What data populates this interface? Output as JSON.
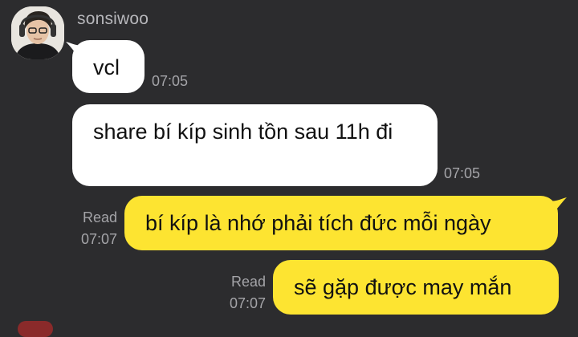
{
  "sender": {
    "name": "sonsiwoo",
    "avatar_icon": "profile-photo"
  },
  "messages": [
    {
      "direction": "in",
      "text": "vcl",
      "time": "07:05"
    },
    {
      "direction": "in",
      "text": "share bí kíp sinh tồn sau 11h đi",
      "time": "07:05"
    },
    {
      "direction": "out",
      "status": "Read",
      "text": "bí kíp là nhớ phải tích đức mỗi ngày",
      "time": "07:07"
    },
    {
      "direction": "out",
      "status": "Read",
      "text": "sẽ gặp được may mắn",
      "time": "07:07"
    }
  ],
  "colors": {
    "background": "#2c2c2e",
    "incoming_bubble": "#ffffff",
    "outgoing_bubble": "#fde431",
    "meta_text": "#a4a4a8"
  }
}
